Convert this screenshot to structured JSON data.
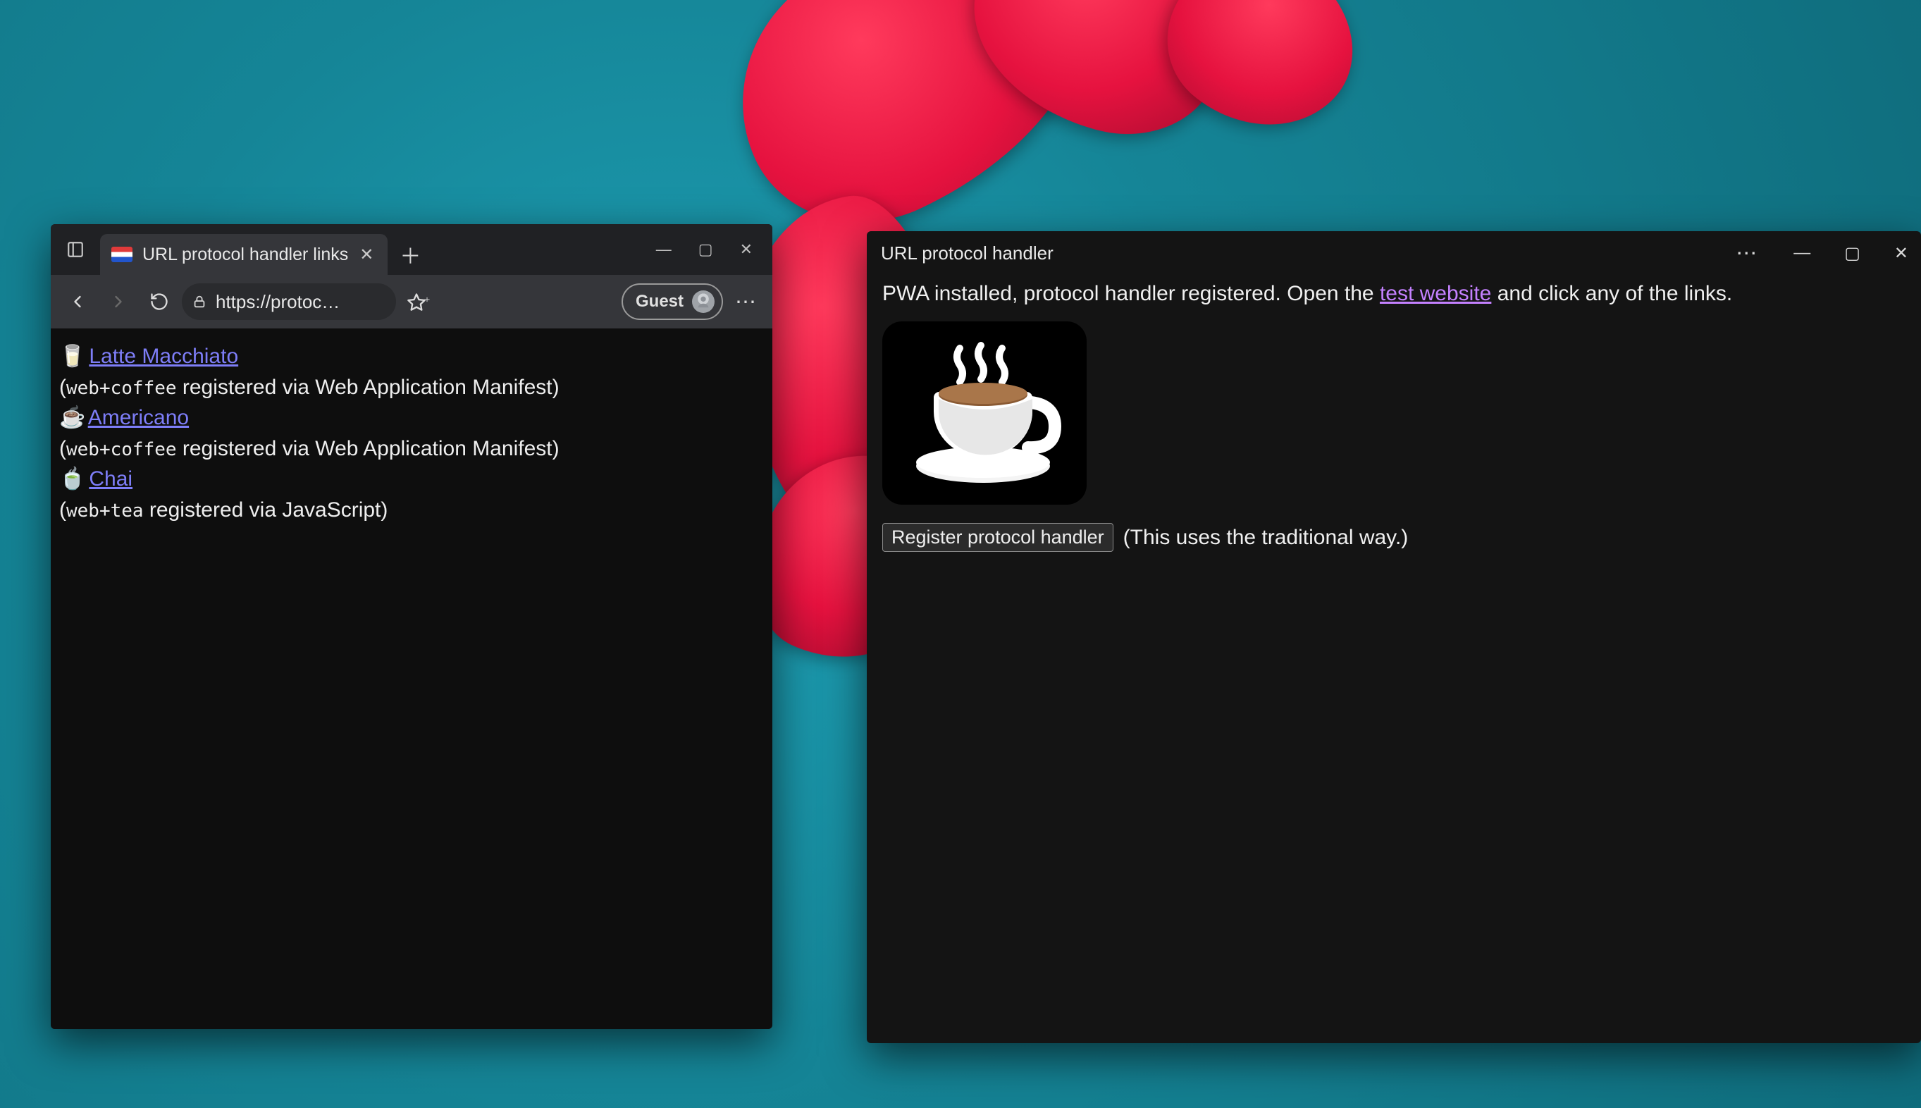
{
  "browser": {
    "tab": {
      "title": "URL protocol handler links"
    },
    "address": "https://protoc…",
    "guest_label": "Guest",
    "links": [
      {
        "emoji": "🥛",
        "text": "Latte Macchiato",
        "proto": "web+coffee",
        "via": " registered via Web Application Manifest)"
      },
      {
        "emoji": "☕",
        "text": "Americano",
        "proto": "web+coffee",
        "via": " registered via Web Application Manifest)"
      },
      {
        "emoji": "🍵",
        "text": "Chai",
        "proto": "web+tea",
        "via": " registered via JavaScript)"
      }
    ]
  },
  "pwa": {
    "title": "URL protocol handler",
    "line_before_link": "PWA installed, protocol handler registered. Open the ",
    "link_text": "test website",
    "line_after_link": " and click any of the links.",
    "button_label": "Register protocol handler",
    "button_note": "(This uses the traditional way.)"
  }
}
